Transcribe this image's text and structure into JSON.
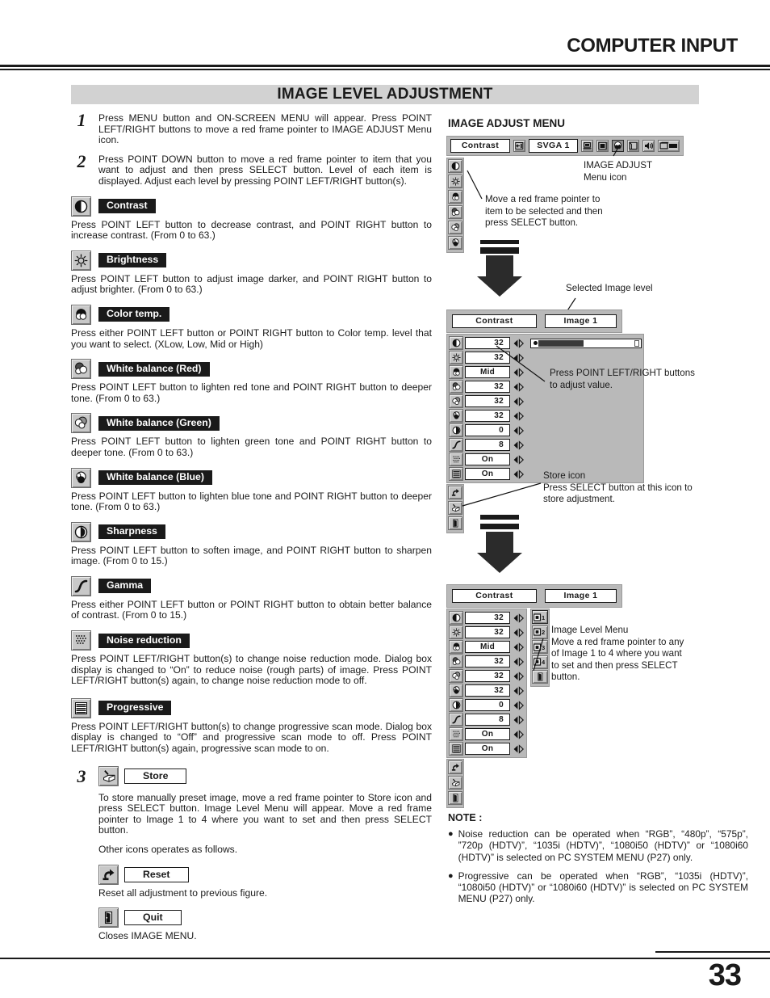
{
  "header": {
    "title": "COMPUTER INPUT"
  },
  "banner": {
    "title": "IMAGE LEVEL ADJUSTMENT"
  },
  "page_number": "33",
  "steps": [
    {
      "num": "1",
      "text": "Press MENU button and ON-SCREEN MENU will appear.  Press POINT LEFT/RIGHT buttons to move a red frame pointer to IMAGE ADJUST Menu icon."
    },
    {
      "num": "2",
      "text": "Press POINT DOWN button to move a red frame pointer to item that you want to adjust and then press SELECT button. Level of each item is displayed. Adjust each level by pressing POINT LEFT/RIGHT button(s)."
    }
  ],
  "items": [
    {
      "icon": "contrast-icon",
      "label": "Contrast",
      "text": "Press POINT LEFT button to decrease contrast, and POINT RIGHT button to increase contrast.  (From 0 to 63.)"
    },
    {
      "icon": "brightness-icon",
      "label": "Brightness",
      "text": "Press POINT LEFT button to adjust image darker, and POINT RIGHT button to adjust brighter.  (From 0 to 63.)"
    },
    {
      "icon": "color-temp-icon",
      "label": "Color temp.",
      "text": "Press either POINT LEFT button or POINT RIGHT button to Color temp. level that you want to select. (XLow, Low, Mid or High)"
    },
    {
      "icon": "white-balance-red-icon",
      "label": "White balance (Red)",
      "text": "Press POINT LEFT button to lighten red tone and POINT RIGHT button to deeper tone.  (From 0 to 63.)"
    },
    {
      "icon": "white-balance-green-icon",
      "label": "White balance (Green)",
      "text": "Press POINT LEFT button to lighten green tone and POINT RIGHT button to deeper tone.  (From 0 to 63.)"
    },
    {
      "icon": "white-balance-blue-icon",
      "label": "White balance (Blue)",
      "text": "Press POINT LEFT button to lighten blue tone and POINT RIGHT button to deeper tone.  (From 0 to 63.)"
    },
    {
      "icon": "sharpness-icon",
      "label": "Sharpness",
      "text": "Press POINT LEFT button to soften image, and POINT RIGHT button to sharpen image.  (From 0 to 15.)"
    },
    {
      "icon": "gamma-icon",
      "label": "Gamma",
      "text": "Press either POINT LEFT button or POINT RIGHT button to obtain better balance of contrast.  (From 0 to 15.)"
    },
    {
      "icon": "noise-reduction-icon",
      "label": "Noise reduction",
      "text": "Press POINT LEFT/RIGHT button(s) to change noise reduction mode.  Dialog box display is changed to “On” to reduce noise (rough parts) of  image. Press POINT LEFT/RIGHT button(s) again, to change noise reduction mode to off."
    },
    {
      "icon": "progressive-icon",
      "label": "Progressive",
      "text": "Press POINT LEFT/RIGHT button(s) to change progressive scan mode. Dialog box display is changed to “Off” and progressive scan mode to off. Press POINT LEFT/RIGHT button(s) again, progressive scan mode to on."
    }
  ],
  "step3": {
    "num": "3",
    "store_label": "Store",
    "store_text": "To store manually preset image, move a red frame pointer to Store icon and press SELECT button.  Image Level Menu will appear.  Move a red frame pointer to Image 1 to 4 where you want to set and then press SELECT button.",
    "other_text": "Other icons operates as follows.",
    "reset_label": "Reset",
    "reset_text": "Reset all adjustment to previous figure.",
    "quit_label": "Quit",
    "quit_text": "Closes IMAGE MENU."
  },
  "menu_diagram": {
    "title": "IMAGE ADJUST MENU",
    "top_bar": {
      "selected_item": "Contrast",
      "system": "SVGA 1",
      "icons": [
        "input-source-icon",
        "computer-icon",
        "screen-icon",
        "image-adjust-icon",
        "pc-adjust-icon",
        "sound-icon",
        "setting-icon"
      ]
    },
    "callout_menu_icon": "IMAGE ADJUST\nMenu icon",
    "callout_pointer": "Move a red frame pointer to\nitem to be selected and then\npress SELECT button.",
    "callout_image_level": "Selected Image level",
    "callout_adjust_value": "Press POINT LEFT/RIGHT buttons\nto adjust value.",
    "callout_store": "Store icon\nPress SELECT button at this icon to\nstore adjustment.",
    "callout_image_level_menu": "Image Level Menu\nMove a red frame pointer to any\nof Image 1 to 4 where you want\nto set  and then press SELECT\nbutton."
  },
  "adjust_dialog": {
    "header_left": "Contrast",
    "header_right": "Image 1",
    "rows": [
      {
        "icon": "contrast-icon",
        "value": "32",
        "type": "num",
        "slider": true
      },
      {
        "icon": "brightness-icon",
        "value": "32",
        "type": "num"
      },
      {
        "icon": "color-temp-icon",
        "value": "Mid",
        "type": "text"
      },
      {
        "icon": "white-balance-red-icon",
        "value": "32",
        "type": "num"
      },
      {
        "icon": "white-balance-green-icon",
        "value": "32",
        "type": "num"
      },
      {
        "icon": "white-balance-blue-icon",
        "value": "32",
        "type": "num"
      },
      {
        "icon": "sharpness-icon",
        "value": "0",
        "type": "num"
      },
      {
        "icon": "gamma-icon",
        "value": "8",
        "type": "num"
      },
      {
        "icon": "noise-reduction-icon",
        "value": "On",
        "type": "text"
      },
      {
        "icon": "progressive-icon",
        "value": "On",
        "type": "text"
      }
    ],
    "footer_icons": [
      "reset-icon",
      "store-icon",
      "quit-icon"
    ]
  },
  "image_level_menu": {
    "options": [
      "1",
      "2",
      "3",
      "4"
    ],
    "quit_icon": "quit-icon"
  },
  "note": {
    "title": "NOTE :",
    "items": [
      "Noise reduction can be operated when  “RGB”, “480p”, “575p”, ”720p (HDTV)”, “1035i (HDTV)”, “1080i50 (HDTV)” or “1080i60 (HDTV)” is selected on PC SYSTEM MENU (P27) only.",
      "Progressive can be operated when  “RGB”, “1035i (HDTV)”, “1080i50 (HDTV)” or “1080i60 (HDTV)” is selected on PC SYSTEM MENU (P27) only."
    ]
  },
  "colors": {
    "banner_bg": "#d2d2d2",
    "osd_bg": "#b9b9b9",
    "ink": "#1a1a1a"
  }
}
